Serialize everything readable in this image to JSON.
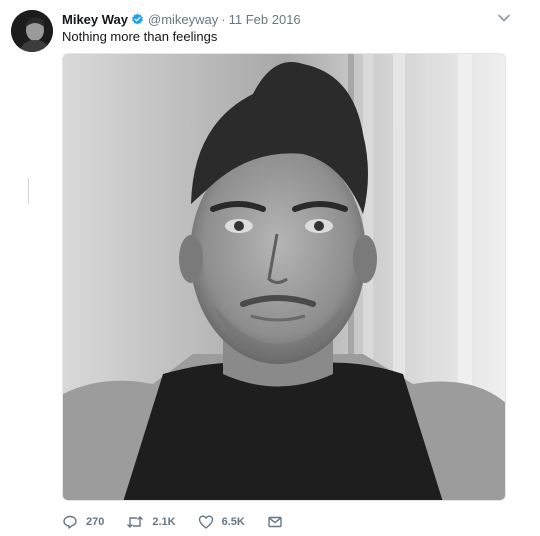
{
  "tweet": {
    "display_name": "Mikey Way",
    "handle": "@mikeyway",
    "separator": "·",
    "date": "11 Feb 2016",
    "text": "Nothing more than feelings",
    "verified": true
  },
  "actions": {
    "replies": "270",
    "retweets": "2.1K",
    "likes": "6.5K"
  },
  "icons": {
    "verified": "verified-badge-icon",
    "menu": "chevron-down-icon",
    "reply": "reply-icon",
    "retweet": "retweet-icon",
    "like": "heart-icon",
    "dm": "envelope-icon"
  },
  "colors": {
    "verified_blue": "#1da1f2",
    "secondary_text": "#657786",
    "primary_text": "#14171a"
  }
}
